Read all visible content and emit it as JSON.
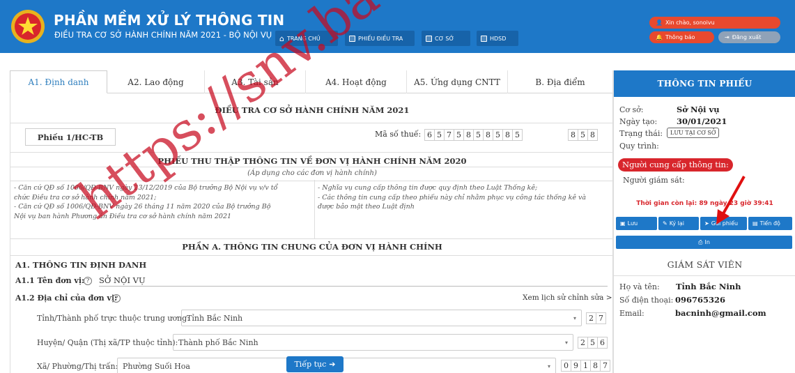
{
  "header": {
    "title": "PHẦN MỀM XỬ LÝ THÔNG TIN",
    "subtitle": "ĐIỀU TRA CƠ SỞ HÀNH CHÍNH NĂM 2021 - BỘ NỘI VỤ",
    "nav": [
      {
        "label": "TRANG CHỦ",
        "icon": "home-icon"
      },
      {
        "label": "PHIẾU ĐIỀU TRA",
        "icon": "document-icon"
      },
      {
        "label": "CƠ SỞ",
        "icon": "folder-icon"
      },
      {
        "label": "HDSD",
        "icon": "book-icon"
      }
    ],
    "greeting": "Xin chào, sonoivu",
    "notification_label": "Thông báo",
    "logout_label": "Đăng xuất",
    "colors": {
      "bar": "#1e78c8",
      "pill_red": "#e8492e",
      "pill_gray": "#8fa2b8"
    }
  },
  "tabs": [
    {
      "label": "A1. Định danh",
      "active": true
    },
    {
      "label": "A2. Lao động",
      "active": false
    },
    {
      "label": "A3. Tài sản",
      "active": false
    },
    {
      "label": "A4. Hoạt động",
      "active": false
    },
    {
      "label": "A5. Ứng dụng CNTT",
      "active": false
    },
    {
      "label": "B. Địa điểm",
      "active": false
    }
  ],
  "form": {
    "survey_title": "ĐIỀU TRA CƠ SỞ HÀNH CHÍNH NĂM 2021",
    "form_code": "Phiếu 1/HC-TB",
    "tax_label": "Mã số thuế:",
    "tax_digits": [
      "6",
      "5",
      "7",
      "5",
      "8",
      "5",
      "8",
      "5",
      "8",
      "5"
    ],
    "tax_suffix": [
      "8",
      "5",
      "8"
    ],
    "collect_title": "PHIẾU THU THẬP THÔNG TIN VỀ ĐƠN VỊ HÀNH CHÍNH NĂM 2020",
    "apply_note": "(Áp dụng cho các đơn vị hành chính)",
    "legal_left_1": "- Căn cứ QĐ số 1006/QĐ-BNV ngày 23/12/2019 của Bộ trưởng Bộ Nội vụ v/v tổ",
    "legal_left_2": "chức Điều tra cơ sở hành chính năm 2021;",
    "legal_left_3": "- Căn cứ QĐ số 1006/QĐ-BNV ngày 26 tháng 11 năm 2020 của Bộ trưởng Bộ",
    "legal_left_4": "Nội vụ ban hành Phương án Điều tra cơ sở hành chính năm 2021",
    "legal_right_1": "- Nghĩa vụ cung cấp thông tin được quy định theo Luật Thống kê;",
    "legal_right_2": "- Các thông tin cung cấp theo phiếu này chỉ nhằm phục vụ công tác thống kê và",
    "legal_right_3": "được bảo mật theo Luật định",
    "part_a_title": "PHẦN A. THÔNG TIN CHUNG CỦA ĐƠN VỊ HÀNH CHÍNH",
    "a1_title": "A1. THÔNG TIN ĐỊNH DANH",
    "a11_label": "A1.1 Tên đơn vị:",
    "a11_value": "SỞ NỘI VỤ",
    "a12_label": "A1.2 Địa chỉ của đơn vị:",
    "history_link": "Xem lịch sử chỉnh sửa >",
    "province_label": "Tỉnh/Thành phố trực thuộc trung ương:",
    "province_value": "Tỉnh Bắc Ninh",
    "province_code": [
      "2",
      "7"
    ],
    "district_label": "Huyện/ Quận (Thị xã/TP thuộc tỉnh):",
    "district_value": "Thành phố Bắc Ninh",
    "district_code": [
      "2",
      "5",
      "6"
    ],
    "ward_label": "Xã/ Phường/Thị trấn:",
    "ward_value": "Phường Suối Hoa",
    "ward_code": [
      "0",
      "9",
      "1",
      "8",
      "7"
    ],
    "continue_label": "Tiếp tục"
  },
  "sidebar": {
    "info_title": "THÔNG TIN PHIẾU",
    "facility_label": "Cơ sở:",
    "facility_value": "Sở Nội vụ",
    "created_label": "Ngày tạo:",
    "created_value": "30/01/2021",
    "status_label": "Trạng thái:",
    "status_value": "LƯU TẠI CƠ SỞ",
    "process_label": "Quy trình:",
    "provider_label": "Người cung cấp thông tin:",
    "monitor_label": "Người giám sát:",
    "time_left": "Thời gian còn lại: 89 ngày 23 giờ 39:41",
    "actions": [
      {
        "label": "Lưu",
        "icon": "save-icon"
      },
      {
        "label": "Ký lại",
        "icon": "sign-icon"
      },
      {
        "label": "Gửi phiếu",
        "icon": "send-icon"
      },
      {
        "label": "Tiến độ",
        "icon": "progress-icon"
      }
    ],
    "print_label": "In",
    "supervisor_title": "GIÁM SÁT VIÊN",
    "sup_name_label": "Họ và tên:",
    "sup_name_value": "Tỉnh Bắc Ninh",
    "sup_phone_label": "Số điện thoại:",
    "sup_phone_value": "096765326",
    "sup_email_label": "Email:",
    "sup_email_value": "bacninh@gmail.com"
  },
  "watermark": "https://snv.bacninh"
}
